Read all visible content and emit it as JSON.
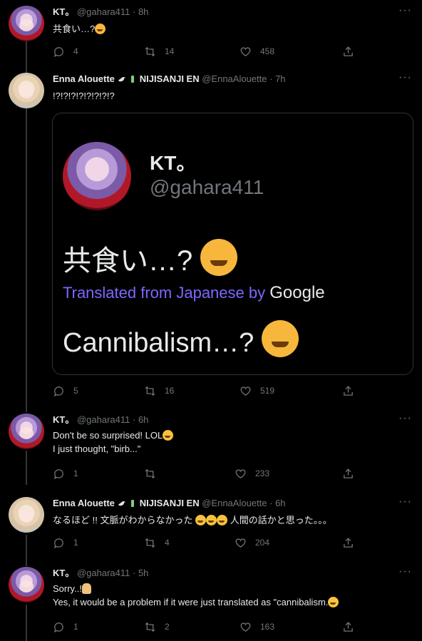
{
  "tweets": [
    {
      "name": "KT。",
      "handle": "@gahara411",
      "time": "· 8h",
      "lines": [
        "共食い…?"
      ],
      "replies": "4",
      "retweets": "14",
      "likes": "458"
    },
    {
      "name": "Enna Alouette",
      "org": "NIJISANJI EN",
      "handle": "@EnnaAlouette",
      "time": "· 7h",
      "lines": [
        "!?!?!?!?!?!?!?!?"
      ],
      "replies": "5",
      "retweets": "16",
      "likes": "519",
      "embed": {
        "name": "KT。",
        "handle": "@gahara411",
        "original": "共食い…?",
        "translated_label": "Translated from Japanese by",
        "translator": "Google",
        "translation": "Cannibalism…?"
      }
    },
    {
      "name": "KT。",
      "handle": "@gahara411",
      "time": "· 6h",
      "lines": [
        "Don't be so surprised! LOL",
        "I just thought, \"birb...\""
      ],
      "replies": "1",
      "retweets": "",
      "likes": "233"
    },
    {
      "name": "Enna Alouette",
      "org": "NIJISANJI EN",
      "handle": "@EnnaAlouette",
      "time": "· 6h",
      "lines": [
        "なるほど !! 文脈がわからなかった",
        "人間の話かと思った。。。"
      ],
      "replies": "1",
      "retweets": "4",
      "likes": "204"
    },
    {
      "name": "KT。",
      "handle": "@gahara411",
      "time": "· 5h",
      "lines": [
        "Sorry..!",
        "Yes, it would be a problem if it were just translated as \"cannibalism."
      ],
      "replies": "1",
      "retweets": "2",
      "likes": "163"
    }
  ],
  "more_label": "···",
  "icons": {
    "reply": "reply-icon",
    "retweet": "retweet-icon",
    "like": "heart-icon",
    "share": "share-icon",
    "more": "more-icon"
  },
  "colors": {
    "background": "#000000",
    "text": "#e7e9ea",
    "muted": "#71767b",
    "translate": "#7f66ff"
  }
}
